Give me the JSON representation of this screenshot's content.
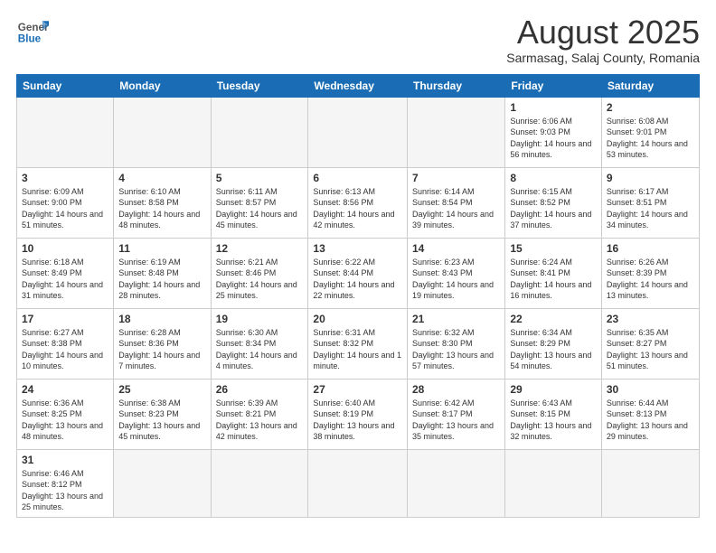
{
  "header": {
    "logo_general": "General",
    "logo_blue": "Blue",
    "month_title": "August 2025",
    "subtitle": "Sarmasag, Salaj County, Romania"
  },
  "weekdays": [
    "Sunday",
    "Monday",
    "Tuesday",
    "Wednesday",
    "Thursday",
    "Friday",
    "Saturday"
  ],
  "weeks": [
    [
      {
        "day": "",
        "info": ""
      },
      {
        "day": "",
        "info": ""
      },
      {
        "day": "",
        "info": ""
      },
      {
        "day": "",
        "info": ""
      },
      {
        "day": "",
        "info": ""
      },
      {
        "day": "1",
        "info": "Sunrise: 6:06 AM\nSunset: 9:03 PM\nDaylight: 14 hours and 56 minutes."
      },
      {
        "day": "2",
        "info": "Sunrise: 6:08 AM\nSunset: 9:01 PM\nDaylight: 14 hours and 53 minutes."
      }
    ],
    [
      {
        "day": "3",
        "info": "Sunrise: 6:09 AM\nSunset: 9:00 PM\nDaylight: 14 hours and 51 minutes."
      },
      {
        "day": "4",
        "info": "Sunrise: 6:10 AM\nSunset: 8:58 PM\nDaylight: 14 hours and 48 minutes."
      },
      {
        "day": "5",
        "info": "Sunrise: 6:11 AM\nSunset: 8:57 PM\nDaylight: 14 hours and 45 minutes."
      },
      {
        "day": "6",
        "info": "Sunrise: 6:13 AM\nSunset: 8:56 PM\nDaylight: 14 hours and 42 minutes."
      },
      {
        "day": "7",
        "info": "Sunrise: 6:14 AM\nSunset: 8:54 PM\nDaylight: 14 hours and 39 minutes."
      },
      {
        "day": "8",
        "info": "Sunrise: 6:15 AM\nSunset: 8:52 PM\nDaylight: 14 hours and 37 minutes."
      },
      {
        "day": "9",
        "info": "Sunrise: 6:17 AM\nSunset: 8:51 PM\nDaylight: 14 hours and 34 minutes."
      }
    ],
    [
      {
        "day": "10",
        "info": "Sunrise: 6:18 AM\nSunset: 8:49 PM\nDaylight: 14 hours and 31 minutes."
      },
      {
        "day": "11",
        "info": "Sunrise: 6:19 AM\nSunset: 8:48 PM\nDaylight: 14 hours and 28 minutes."
      },
      {
        "day": "12",
        "info": "Sunrise: 6:21 AM\nSunset: 8:46 PM\nDaylight: 14 hours and 25 minutes."
      },
      {
        "day": "13",
        "info": "Sunrise: 6:22 AM\nSunset: 8:44 PM\nDaylight: 14 hours and 22 minutes."
      },
      {
        "day": "14",
        "info": "Sunrise: 6:23 AM\nSunset: 8:43 PM\nDaylight: 14 hours and 19 minutes."
      },
      {
        "day": "15",
        "info": "Sunrise: 6:24 AM\nSunset: 8:41 PM\nDaylight: 14 hours and 16 minutes."
      },
      {
        "day": "16",
        "info": "Sunrise: 6:26 AM\nSunset: 8:39 PM\nDaylight: 14 hours and 13 minutes."
      }
    ],
    [
      {
        "day": "17",
        "info": "Sunrise: 6:27 AM\nSunset: 8:38 PM\nDaylight: 14 hours and 10 minutes."
      },
      {
        "day": "18",
        "info": "Sunrise: 6:28 AM\nSunset: 8:36 PM\nDaylight: 14 hours and 7 minutes."
      },
      {
        "day": "19",
        "info": "Sunrise: 6:30 AM\nSunset: 8:34 PM\nDaylight: 14 hours and 4 minutes."
      },
      {
        "day": "20",
        "info": "Sunrise: 6:31 AM\nSunset: 8:32 PM\nDaylight: 14 hours and 1 minute."
      },
      {
        "day": "21",
        "info": "Sunrise: 6:32 AM\nSunset: 8:30 PM\nDaylight: 13 hours and 57 minutes."
      },
      {
        "day": "22",
        "info": "Sunrise: 6:34 AM\nSunset: 8:29 PM\nDaylight: 13 hours and 54 minutes."
      },
      {
        "day": "23",
        "info": "Sunrise: 6:35 AM\nSunset: 8:27 PM\nDaylight: 13 hours and 51 minutes."
      }
    ],
    [
      {
        "day": "24",
        "info": "Sunrise: 6:36 AM\nSunset: 8:25 PM\nDaylight: 13 hours and 48 minutes."
      },
      {
        "day": "25",
        "info": "Sunrise: 6:38 AM\nSunset: 8:23 PM\nDaylight: 13 hours and 45 minutes."
      },
      {
        "day": "26",
        "info": "Sunrise: 6:39 AM\nSunset: 8:21 PM\nDaylight: 13 hours and 42 minutes."
      },
      {
        "day": "27",
        "info": "Sunrise: 6:40 AM\nSunset: 8:19 PM\nDaylight: 13 hours and 38 minutes."
      },
      {
        "day": "28",
        "info": "Sunrise: 6:42 AM\nSunset: 8:17 PM\nDaylight: 13 hours and 35 minutes."
      },
      {
        "day": "29",
        "info": "Sunrise: 6:43 AM\nSunset: 8:15 PM\nDaylight: 13 hours and 32 minutes."
      },
      {
        "day": "30",
        "info": "Sunrise: 6:44 AM\nSunset: 8:13 PM\nDaylight: 13 hours and 29 minutes."
      }
    ],
    [
      {
        "day": "31",
        "info": "Sunrise: 6:46 AM\nSunset: 8:12 PM\nDaylight: 13 hours and 25 minutes."
      },
      {
        "day": "",
        "info": ""
      },
      {
        "day": "",
        "info": ""
      },
      {
        "day": "",
        "info": ""
      },
      {
        "day": "",
        "info": ""
      },
      {
        "day": "",
        "info": ""
      },
      {
        "day": "",
        "info": ""
      }
    ]
  ]
}
